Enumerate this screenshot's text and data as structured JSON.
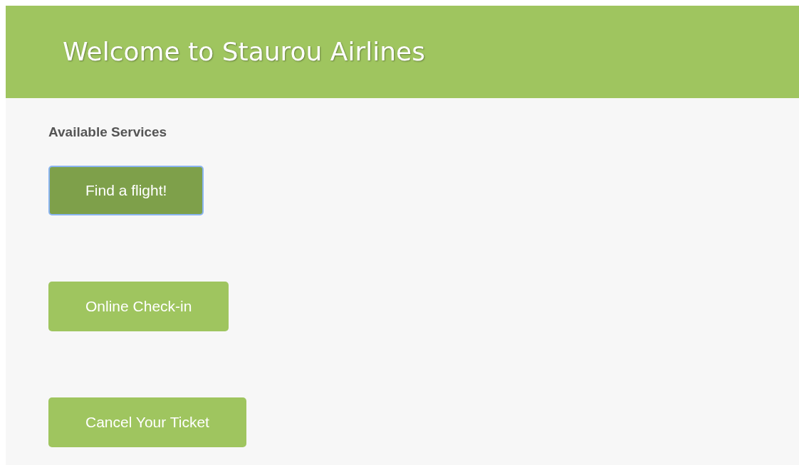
{
  "header": {
    "title": "Welcome to Staurou Airlines"
  },
  "section": {
    "heading": "Available Services"
  },
  "services": [
    {
      "label": "Find a flight!",
      "selected": true
    },
    {
      "label": "Online Check-in",
      "selected": false
    },
    {
      "label": "Cancel Your Ticket",
      "selected": false
    }
  ]
}
